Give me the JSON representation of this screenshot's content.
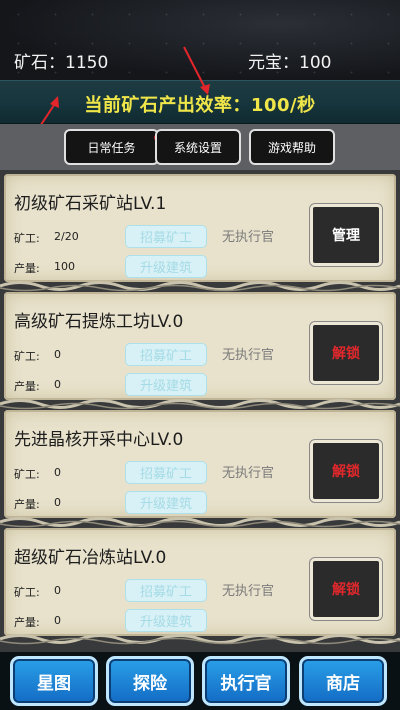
{
  "resources": {
    "ore_label": "矿石：1150",
    "gold_label": "元宝：100"
  },
  "production": {
    "text": "当前矿石产出效率：100/秒"
  },
  "tabs": [
    {
      "label": "日常任务"
    },
    {
      "label": "系统设置"
    },
    {
      "label": "游戏帮助"
    }
  ],
  "labels": {
    "miner": "矿工:",
    "output": "产量:",
    "recruit": "招募矿工",
    "upgrade": "升级建筑",
    "no_officer": "无执行官"
  },
  "buildings": [
    {
      "title": "初级矿石采矿站LV.1",
      "miners": "2/20",
      "output": "100",
      "action": "管理"
    },
    {
      "title": "高级矿石提炼工坊LV.0",
      "miners": "0",
      "output": "0",
      "action": "解锁"
    },
    {
      "title": "先进晶核开采中心LV.0",
      "miners": "0",
      "output": "0",
      "action": "解锁"
    },
    {
      "title": "超级矿石冶炼站LV.0",
      "miners": "0",
      "output": "0",
      "action": "解锁"
    }
  ],
  "nav": [
    {
      "label": "星图"
    },
    {
      "label": "探险"
    },
    {
      "label": "执行官"
    },
    {
      "label": "商店"
    }
  ],
  "colors": {
    "rate_text": "#f0e64a",
    "unlock_text": "#e0282c",
    "nav_blue": "#1e86d8",
    "notification_dot": "#e0202a"
  }
}
